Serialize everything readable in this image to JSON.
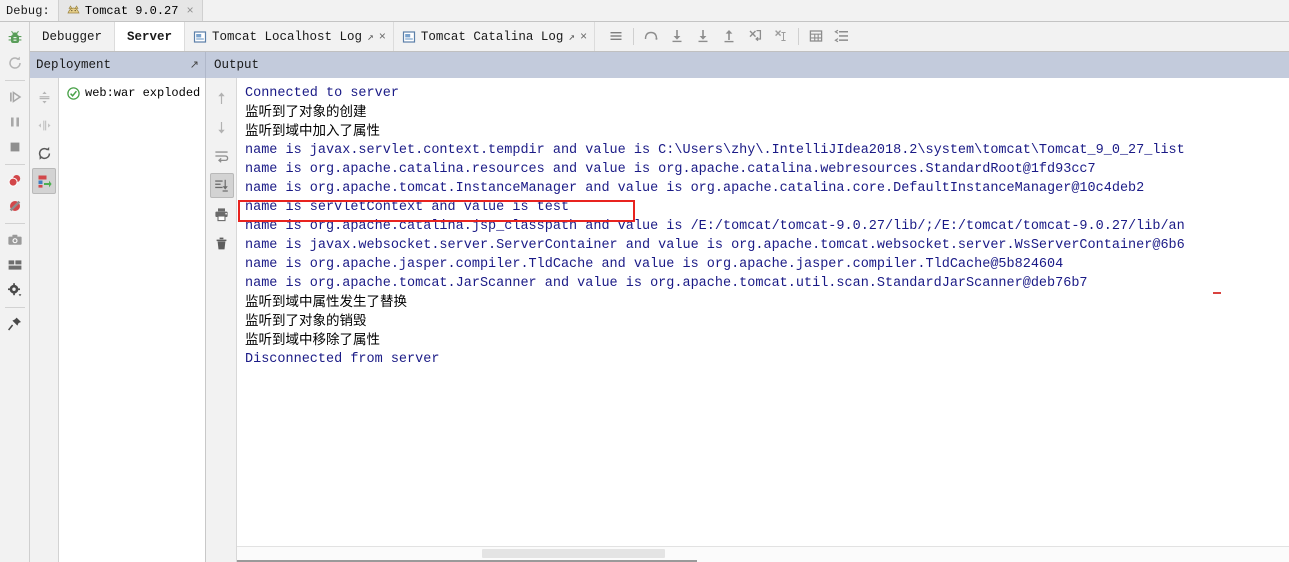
{
  "window": {
    "debug_label": "Debug:",
    "session_tab": {
      "label": "Tomcat 9.0.27",
      "icon": "tomcat-icon",
      "close": "×"
    }
  },
  "left_toolbar": {
    "items": [
      {
        "name": "debug-bug-icon",
        "label": "Debug",
        "color": "#5a9e5a"
      },
      {
        "name": "rerun-icon",
        "label": "Rerun",
        "color": "#b4b4b4"
      },
      {
        "name": "resume-program-icon",
        "label": "Resume Program",
        "color": "#a8a8a8"
      },
      {
        "name": "pause-program-icon",
        "label": "Pause Program",
        "color": "#a8a8a8"
      },
      {
        "name": "stop-icon",
        "label": "Stop",
        "color": "#8f8f8f"
      },
      {
        "name": "view-breakpoints-icon",
        "label": "View Breakpoints",
        "color": "#d2474a"
      },
      {
        "name": "mute-breakpoints-icon",
        "label": "Mute Breakpoints",
        "color": "#d2474a"
      },
      {
        "name": "camera-icon",
        "label": "Capture Memory Snapshot",
        "color": "#9a9a9a"
      },
      {
        "name": "layout-icon",
        "label": "Restore Layout",
        "color": "#6e6e6e"
      },
      {
        "name": "settings-gear-icon",
        "label": "Settings",
        "color": "#4a4a4a"
      },
      {
        "name": "pin-icon",
        "label": "Pin Tab",
        "color": "#4a4a4a"
      }
    ]
  },
  "tabs": {
    "items": [
      {
        "label": "Debugger",
        "active": false,
        "icon": null
      },
      {
        "label": "Server",
        "active": true,
        "icon": null
      },
      {
        "label": "Tomcat Localhost Log",
        "active": false,
        "icon": "log-file-icon",
        "pin": "↗",
        "close": "×"
      },
      {
        "label": "Tomcat Catalina Log",
        "active": false,
        "icon": "log-file-icon",
        "pin": "↗",
        "close": "×"
      }
    ]
  },
  "debug_toolbar": {
    "buttons": [
      {
        "name": "show-execution-point-icon",
        "label": "Menu"
      },
      {
        "name": "step-over-icon",
        "label": "Step Over"
      },
      {
        "name": "step-into-icon",
        "label": "Step Into"
      },
      {
        "name": "force-step-into-icon",
        "label": "Force Step Into"
      },
      {
        "name": "step-out-icon",
        "label": "Step Out"
      },
      {
        "name": "drop-frame-icon",
        "label": "Drop Frame"
      },
      {
        "name": "run-to-cursor-icon",
        "label": "Run to Cursor"
      },
      {
        "name": "evaluate-expression-icon",
        "label": "Evaluate Expression"
      },
      {
        "name": "settings-lines-icon",
        "label": "Layout Settings"
      }
    ]
  },
  "panels": {
    "deployment": {
      "title": "Deployment",
      "pin": "↗"
    },
    "output": {
      "title": "Output"
    }
  },
  "deployment_toolbar": {
    "buttons": [
      {
        "name": "expand-all-icon",
        "label": "Expand All"
      },
      {
        "name": "collapse-all-icon",
        "label": "Collapse All"
      },
      {
        "name": "redeploy-icon",
        "label": "Redeploy"
      },
      {
        "name": "deploy-artifact-icon",
        "label": "Deploy Artifact",
        "selected": true
      }
    ]
  },
  "deployment_tree": {
    "nodes": [
      {
        "label": "web:war exploded",
        "status": "deployed",
        "status_color": "#48a148"
      }
    ]
  },
  "console_toolbar": {
    "buttons": [
      {
        "name": "up-arrow-icon",
        "label": "Previous Occurrence"
      },
      {
        "name": "down-arrow-icon",
        "label": "Next Occurrence"
      },
      {
        "name": "soft-wrap-icon",
        "label": "Use Soft Wraps"
      },
      {
        "name": "scroll-to-end-icon",
        "label": "Scroll to End",
        "selected": true
      },
      {
        "name": "print-icon",
        "label": "Print"
      },
      {
        "name": "trash-icon",
        "label": "Clear All"
      }
    ]
  },
  "console": {
    "lines": [
      {
        "text": "Connected to server",
        "type": "sys"
      },
      {
        "text": "监听到了对象的创建",
        "type": "cn"
      },
      {
        "text": "监听到域中加入了属性",
        "type": "cn"
      },
      {
        "text": "name is javax.servlet.context.tempdir and value is C:\\Users\\zhy\\.IntelliJIdea2018.2\\system\\tomcat\\Tomcat_9_0_27_list",
        "type": "sys"
      },
      {
        "text": "name is org.apache.catalina.resources and value is org.apache.catalina.webresources.StandardRoot@1fd93cc7",
        "type": "sys"
      },
      {
        "text": "name is org.apache.tomcat.InstanceManager and value is org.apache.catalina.core.DefaultInstanceManager@10c4deb2",
        "type": "sys"
      },
      {
        "text": "name is servletContext and value is test",
        "type": "sys",
        "highlighted": true
      },
      {
        "text": "name is org.apache.catalina.jsp_classpath and value is /E:/tomcat/tomcat-9.0.27/lib/;/E:/tomcat/tomcat-9.0.27/lib/an",
        "type": "sys"
      },
      {
        "text": "name is javax.websocket.server.ServerContainer and value is org.apache.tomcat.websocket.server.WsServerContainer@6b6",
        "type": "sys"
      },
      {
        "text": "name is org.apache.jasper.compiler.TldCache and value is org.apache.jasper.compiler.TldCache@5b824604",
        "type": "sys"
      },
      {
        "text": "name is org.apache.tomcat.JarScanner and value is org.apache.tomcat.util.scan.StandardJarScanner@deb76b7",
        "type": "sys"
      },
      {
        "text": "监听到域中属性发生了替换",
        "type": "cn"
      },
      {
        "text": "监听到了对象的销毁",
        "type": "cn"
      },
      {
        "text": "监听到域中移除了属性",
        "type": "cn"
      },
      {
        "text": "Disconnected from server",
        "type": "sys"
      }
    ],
    "highlight_color": "#e8231f"
  },
  "colors": {
    "header_bar": "#c3cbdc",
    "console_text": "#1a1a86",
    "highlight_border": "#e8231f",
    "background": "#f2f2f2"
  }
}
